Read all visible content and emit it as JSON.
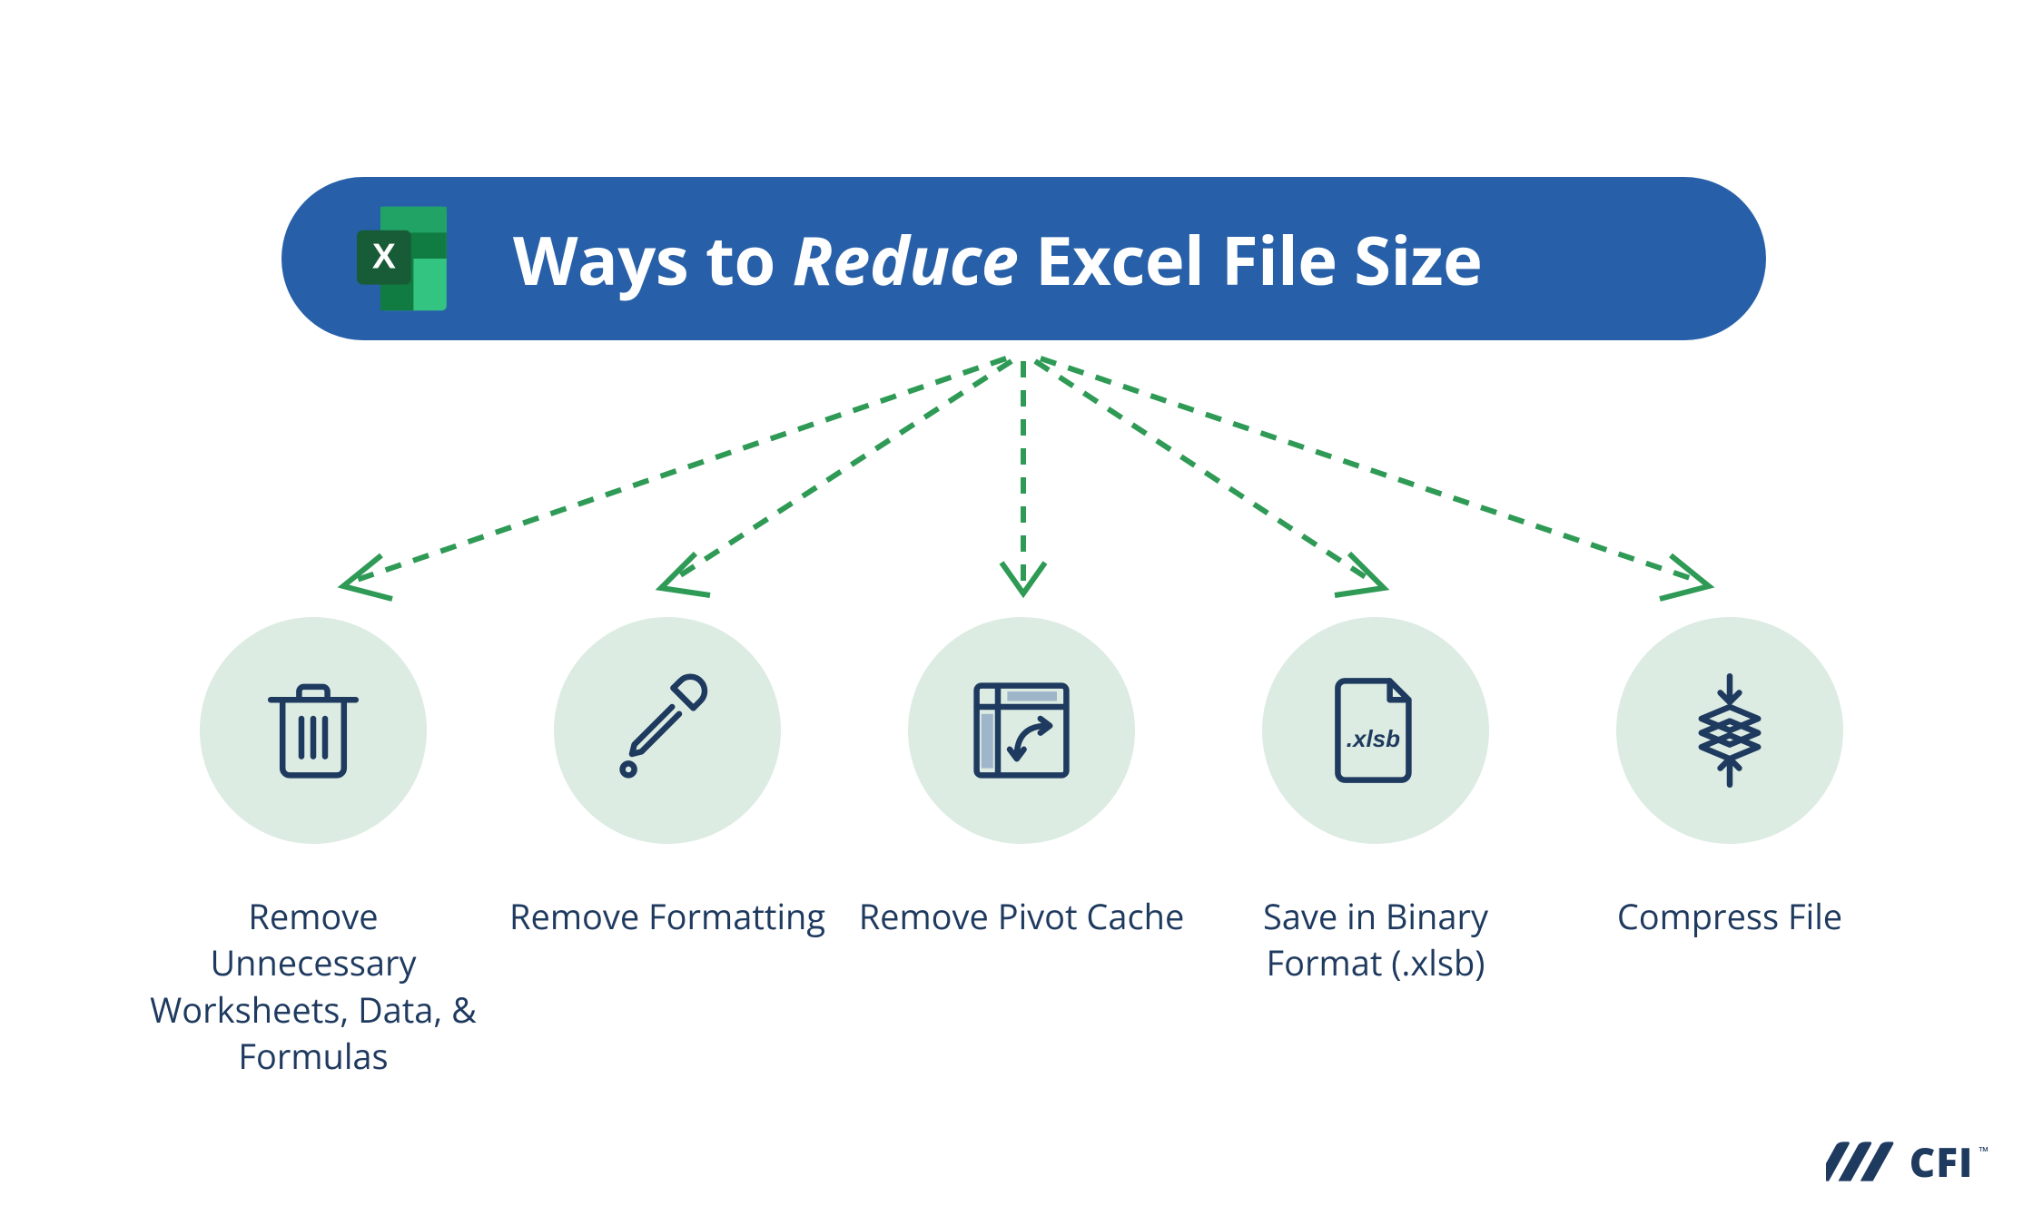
{
  "header": {
    "title_pre": "Ways to ",
    "title_em": "Reduce",
    "title_post": " Excel File Size",
    "icon": "excel-icon"
  },
  "items": [
    {
      "icon": "trash-icon",
      "label": "Remove Unnecessary Worksheets, Data, & Formulas"
    },
    {
      "icon": "eyedropper-icon",
      "label": "Remove Formatting"
    },
    {
      "icon": "pivot-icon",
      "label": "Remove Pivot Cache"
    },
    {
      "icon": "file-xlsb-icon",
      "label": "Save in Binary Format (.xlsb)"
    },
    {
      "icon": "compress-icon",
      "label": "Compress File"
    }
  ],
  "brand": {
    "name": "CFI",
    "tm": "™"
  },
  "colors": {
    "header_bg": "#2760a8",
    "circle_bg": "#dcece2",
    "text_dark": "#1f3a5f",
    "arrow_green": "#2e9a55",
    "icon_stroke": "#1f3a5f"
  }
}
